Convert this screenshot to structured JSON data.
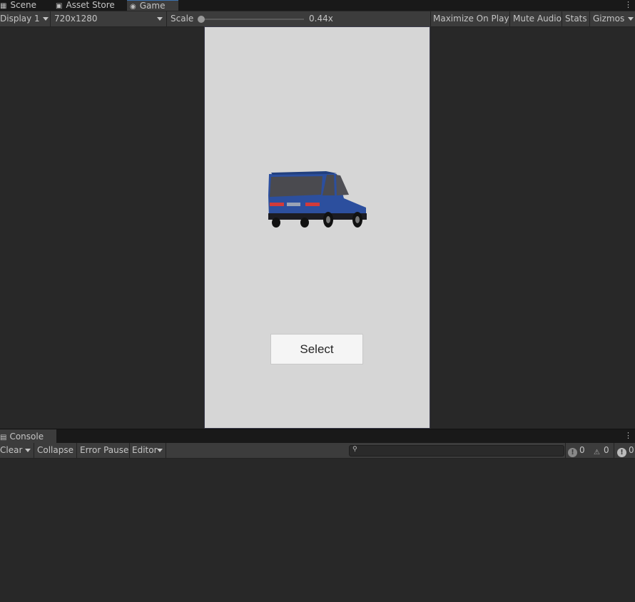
{
  "tabs": [
    {
      "label": "Scene",
      "icon": "grid-icon"
    },
    {
      "label": "Asset Store",
      "icon": "bag-icon"
    },
    {
      "label": "Game",
      "icon": "gamepad-icon",
      "active": true
    }
  ],
  "game_toolbar": {
    "display": "Display 1",
    "resolution": "720x1280",
    "scale_label": "Scale",
    "scale_value": "0.44x",
    "maximize": "Maximize On Play",
    "mute": "Mute Audio",
    "stats": "Stats",
    "gizmos": "Gizmos"
  },
  "game": {
    "select_button": "Select",
    "car_color": "#2c4f9e"
  },
  "console": {
    "tab": "Console",
    "clear": "Clear",
    "collapse": "Collapse",
    "error_pause": "Error Pause",
    "editor": "Editor",
    "log_count": "0",
    "warning_count": "0",
    "error_count": "0"
  }
}
